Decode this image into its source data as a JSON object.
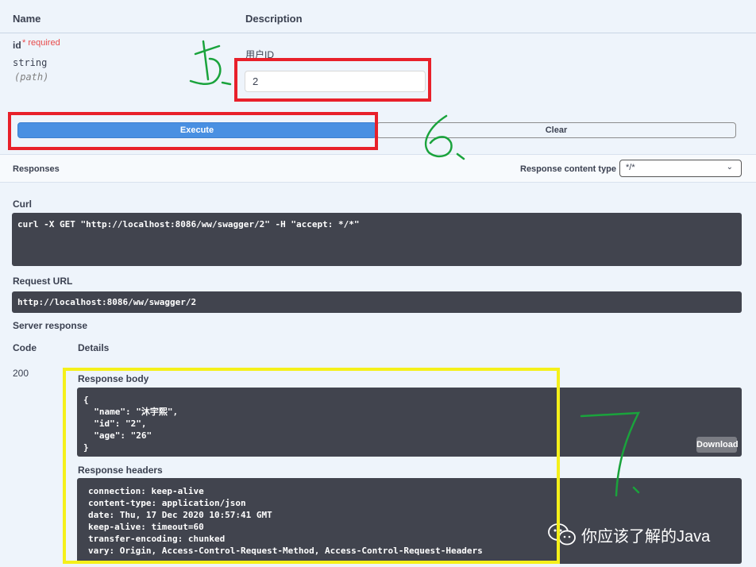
{
  "params": {
    "headers": {
      "name": "Name",
      "description": "Description"
    },
    "id": {
      "name": "id",
      "required": "* required",
      "type": "string",
      "in": "(path)",
      "description": "用户ID",
      "value": "2"
    }
  },
  "buttons": {
    "execute": "Execute",
    "clear": "Clear"
  },
  "responses": {
    "title": "Responses",
    "content_type_label": "Response content type",
    "content_type_value": "*/*"
  },
  "curl": {
    "label": "Curl",
    "command": "curl -X GET \"http://localhost:8086/ww/swagger/2\" -H \"accept: */*\""
  },
  "request_url": {
    "label": "Request URL",
    "value": "http://localhost:8086/ww/swagger/2"
  },
  "server_response": {
    "label": "Server response",
    "code_header": "Code",
    "details_header": "Details",
    "code": "200",
    "body_label": "Response body",
    "body": "{\n  \"name\": \"沐宇熙\",\n  \"id\": \"2\",\n  \"age\": \"26\"\n}",
    "download": "Download",
    "headers_label": "Response headers",
    "headers": "connection: keep-alive\ncontent-type: application/json\ndate: Thu, 17 Dec 2020 10:57:41 GMT\nkeep-alive: timeout=60\ntransfer-encoding: chunked\nvary: Origin, Access-Control-Request-Method, Access-Control-Request-Headers"
  },
  "watermark": {
    "text": "你应该了解的Java",
    "icon": "wechat-icon"
  },
  "annotations": {
    "color_red": "#e8202a",
    "color_green": "#1aa33c",
    "color_yellow": "#f5f01a"
  }
}
